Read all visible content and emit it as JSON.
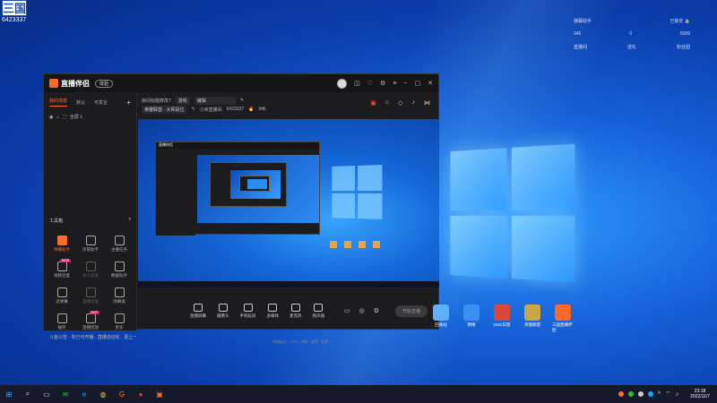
{
  "corner_badge": {
    "label": "三国",
    "number": "6423337"
  },
  "fans_panel": {
    "title": "弹幕助手",
    "status": "已锁定",
    "stats": [
      {
        "value": "346",
        "label": "直播间"
      },
      {
        "value": "0",
        "label": "送礼"
      },
      {
        "value": "6589",
        "label": "粉丝团"
      }
    ]
  },
  "app": {
    "title": "直播伴侣",
    "version_button": "体验",
    "sidebar": {
      "tabs": [
        "我的场景",
        "默认",
        "可发言"
      ],
      "add_symbol": "+",
      "scene_item": "全屏 1",
      "tools_header": "工具箱",
      "tools_help": "?",
      "tools": [
        {
          "label": "弹幕助手",
          "state": "hot"
        },
        {
          "label": "房管助手",
          "state": "normal"
        },
        {
          "label": "主播任务",
          "state": "normal"
        },
        {
          "label": "视频连麦",
          "state": "normal",
          "badge": "NEW"
        },
        {
          "label": "多人连麦",
          "state": "dim"
        },
        {
          "label": "数据助手",
          "state": "normal"
        },
        {
          "label": "读弹幕",
          "state": "normal"
        },
        {
          "label": "直播投屏",
          "state": "dim"
        },
        {
          "label": "弹幕墙",
          "state": "normal"
        },
        {
          "label": "抽奖",
          "state": "normal"
        },
        {
          "label": "直播回放",
          "state": "normal",
          "badge": "HOT"
        },
        {
          "label": "更多",
          "state": "normal"
        }
      ],
      "ticker": "斗鱼公告 · 你已可开播 · 直播自动化 · 更上一层楼"
    },
    "info": {
      "room_title_label": "房间标题修改?",
      "room_tag": "游戏",
      "edit_label": "编辑",
      "category": "英雄联盟 · 大师段位",
      "room_meta": "小米直播间",
      "room_id": "6423337",
      "fans": "346"
    },
    "controls": [
      {
        "label": "直播屏幕"
      },
      {
        "label": "摄像头"
      },
      {
        "label": "手机投屏"
      },
      {
        "label": "多媒体"
      },
      {
        "label": "麦克风"
      },
      {
        "label": "扬声器"
      }
    ],
    "live_button": "开始直播",
    "status_line": "网络延迟 · CPU · 内存 · 帧率 · 码率"
  },
  "desktop_icons": [
    {
      "label": "回收站",
      "color": "#5fb0ff"
    },
    {
      "label": "网络",
      "color": "#3b8ff0"
    },
    {
      "label": "2022日程",
      "color": "#d9483b"
    },
    {
      "label": "英雄联盟",
      "color": "#c9a64a"
    },
    {
      "label": "三国直播伴侣",
      "color": "#ff6a2a"
    }
  ],
  "taskbar": {
    "apps": [
      "⊞",
      "⌕",
      "▭",
      "✉",
      "e",
      "◍",
      "G",
      "●",
      "▣"
    ],
    "clock_time": "23:18",
    "clock_date": "2022/11/7"
  },
  "colors": {
    "accent": "#ff6a2a",
    "danger": "#ff3d3d",
    "wallpaper": "#1660d6"
  }
}
